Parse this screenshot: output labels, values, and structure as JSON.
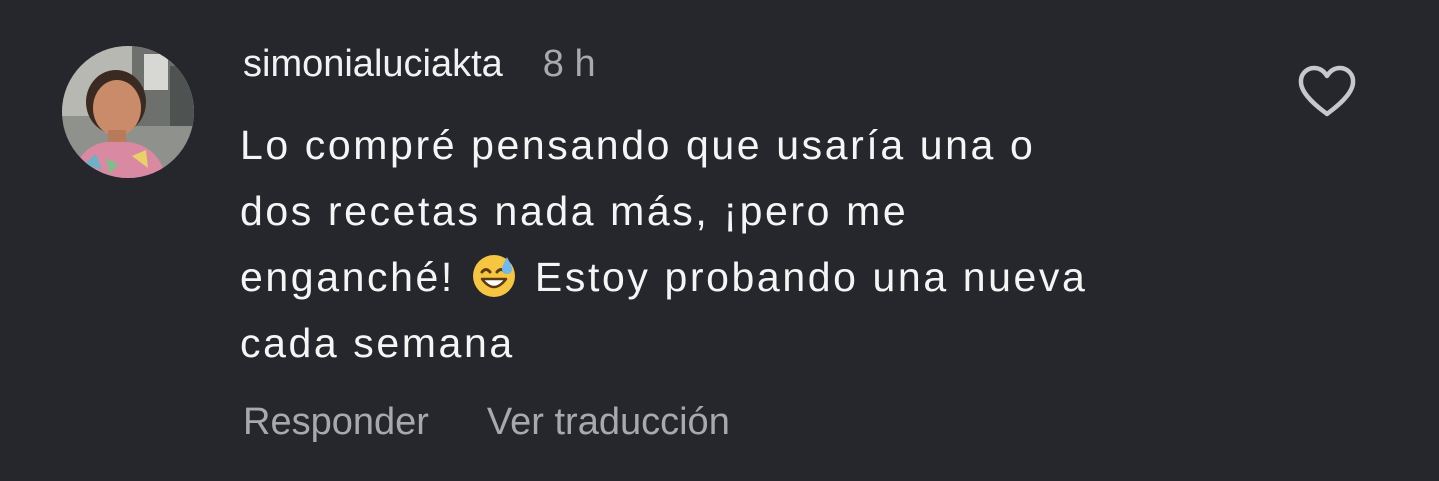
{
  "comment": {
    "author": "simonialuciakta",
    "time_ago": "8 h",
    "text_lines": [
      "Lo compré pensando que usaría una o",
      "dos recetas nada más, ¡pero me",
      "enganché!",
      "Estoy probando una nueva",
      "cada semana"
    ],
    "emoji": "😅"
  },
  "actions": {
    "reply": "Responder",
    "translate": "Ver traducción"
  },
  "icons": {
    "like": "heart-outline-icon",
    "avatar": "profile-photo"
  },
  "colors": {
    "background": "#25272c",
    "primary_text": "#f5f5f5",
    "secondary_text": "#a8a9ad"
  }
}
